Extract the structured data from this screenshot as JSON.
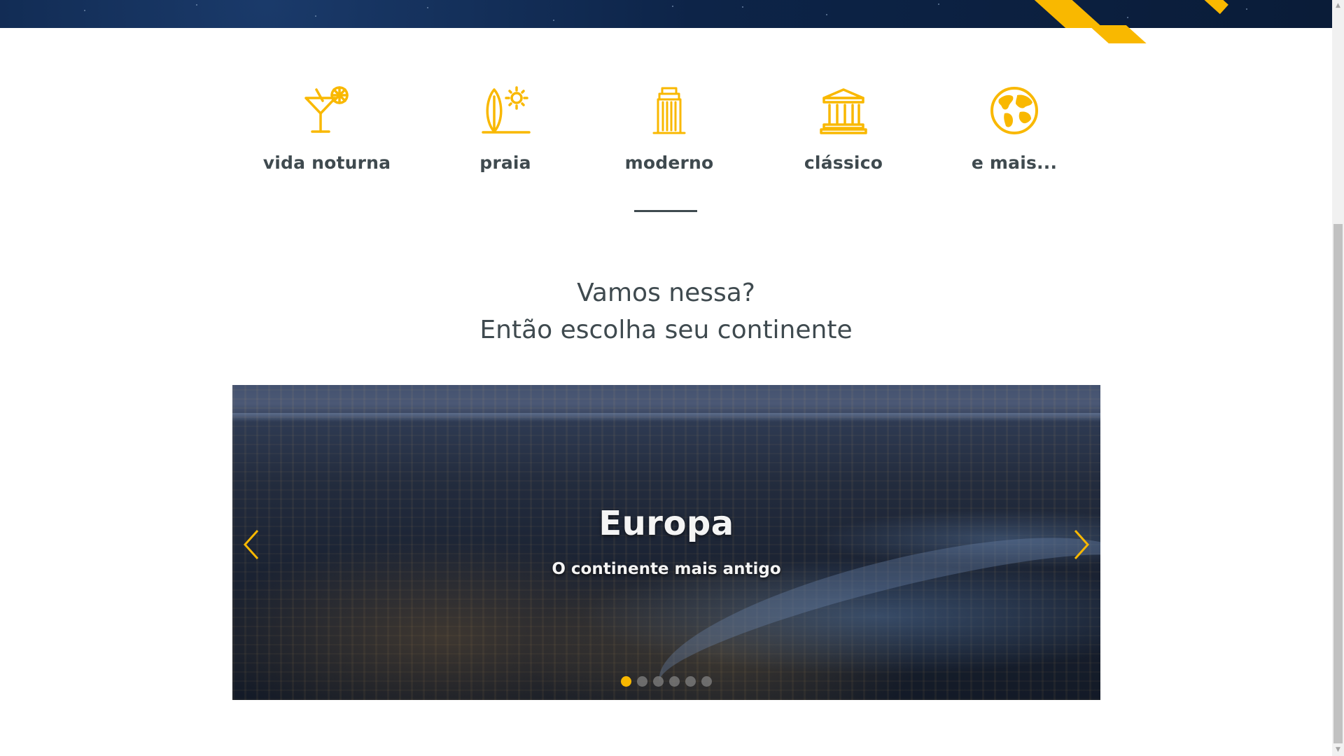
{
  "brand_color": "#f9b800",
  "text_color": "#3f4a4f",
  "categories": [
    {
      "label": "vida noturna",
      "icon": "cocktail-icon"
    },
    {
      "label": "praia",
      "icon": "surfboard-sun-icon"
    },
    {
      "label": "moderno",
      "icon": "skyscraper-icon"
    },
    {
      "label": "clássico",
      "icon": "classical-building-icon"
    },
    {
      "label": "e mais...",
      "icon": "globe-icon"
    }
  ],
  "headline": {
    "line1": "Vamos nessa?",
    "line2": "Então escolha seu continente"
  },
  "carousel": {
    "title": "Europa",
    "subtitle": "O continente mais antigo",
    "slide_count": 6,
    "active_slide": 1
  }
}
